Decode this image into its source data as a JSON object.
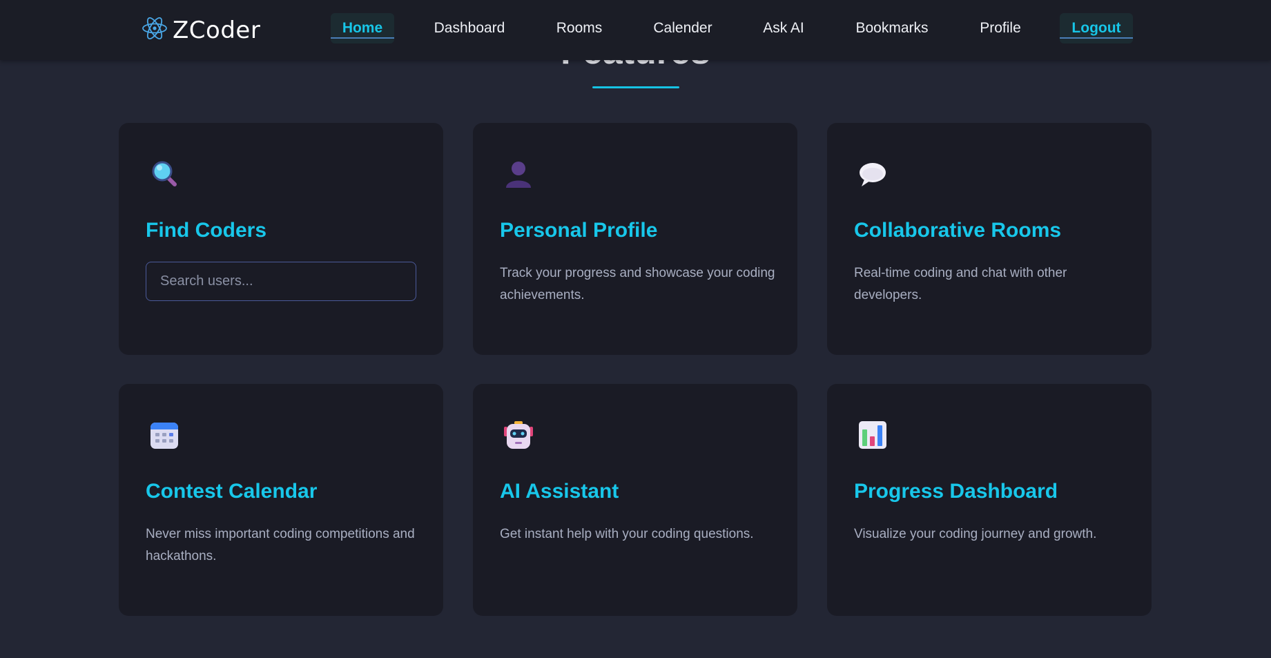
{
  "brand": {
    "name": "ZCoder",
    "logo_icon": "atom-icon"
  },
  "nav": {
    "items": [
      {
        "label": "Home",
        "active": true
      },
      {
        "label": "Dashboard"
      },
      {
        "label": "Rooms"
      },
      {
        "label": "Calender"
      },
      {
        "label": "Ask AI"
      },
      {
        "label": "Bookmarks"
      },
      {
        "label": "Profile"
      },
      {
        "label": "Logout",
        "highlighted": true
      }
    ]
  },
  "section": {
    "title": "Features"
  },
  "features": [
    {
      "icon": "magnifying-glass-icon",
      "title": "Find Coders",
      "search_placeholder": "Search users..."
    },
    {
      "icon": "person-silhouette-icon",
      "title": "Personal Profile",
      "description": "Track your progress and showcase your coding achievements."
    },
    {
      "icon": "speech-bubble-icon",
      "title": "Collaborative Rooms",
      "description": "Real-time coding and chat with other developers."
    },
    {
      "icon": "calendar-icon",
      "title": "Contest Calendar",
      "description": "Never miss important coding competitions and hackathons."
    },
    {
      "icon": "robot-icon",
      "title": "AI Assistant",
      "description": "Get instant help with your coding questions."
    },
    {
      "icon": "bar-chart-icon",
      "title": "Progress Dashboard",
      "description": "Visualize your coding journey and growth."
    }
  ],
  "colors": {
    "accent": "#16c3e4",
    "background": "#232634",
    "card": "#1a1b25",
    "header": "#1b1d26"
  }
}
